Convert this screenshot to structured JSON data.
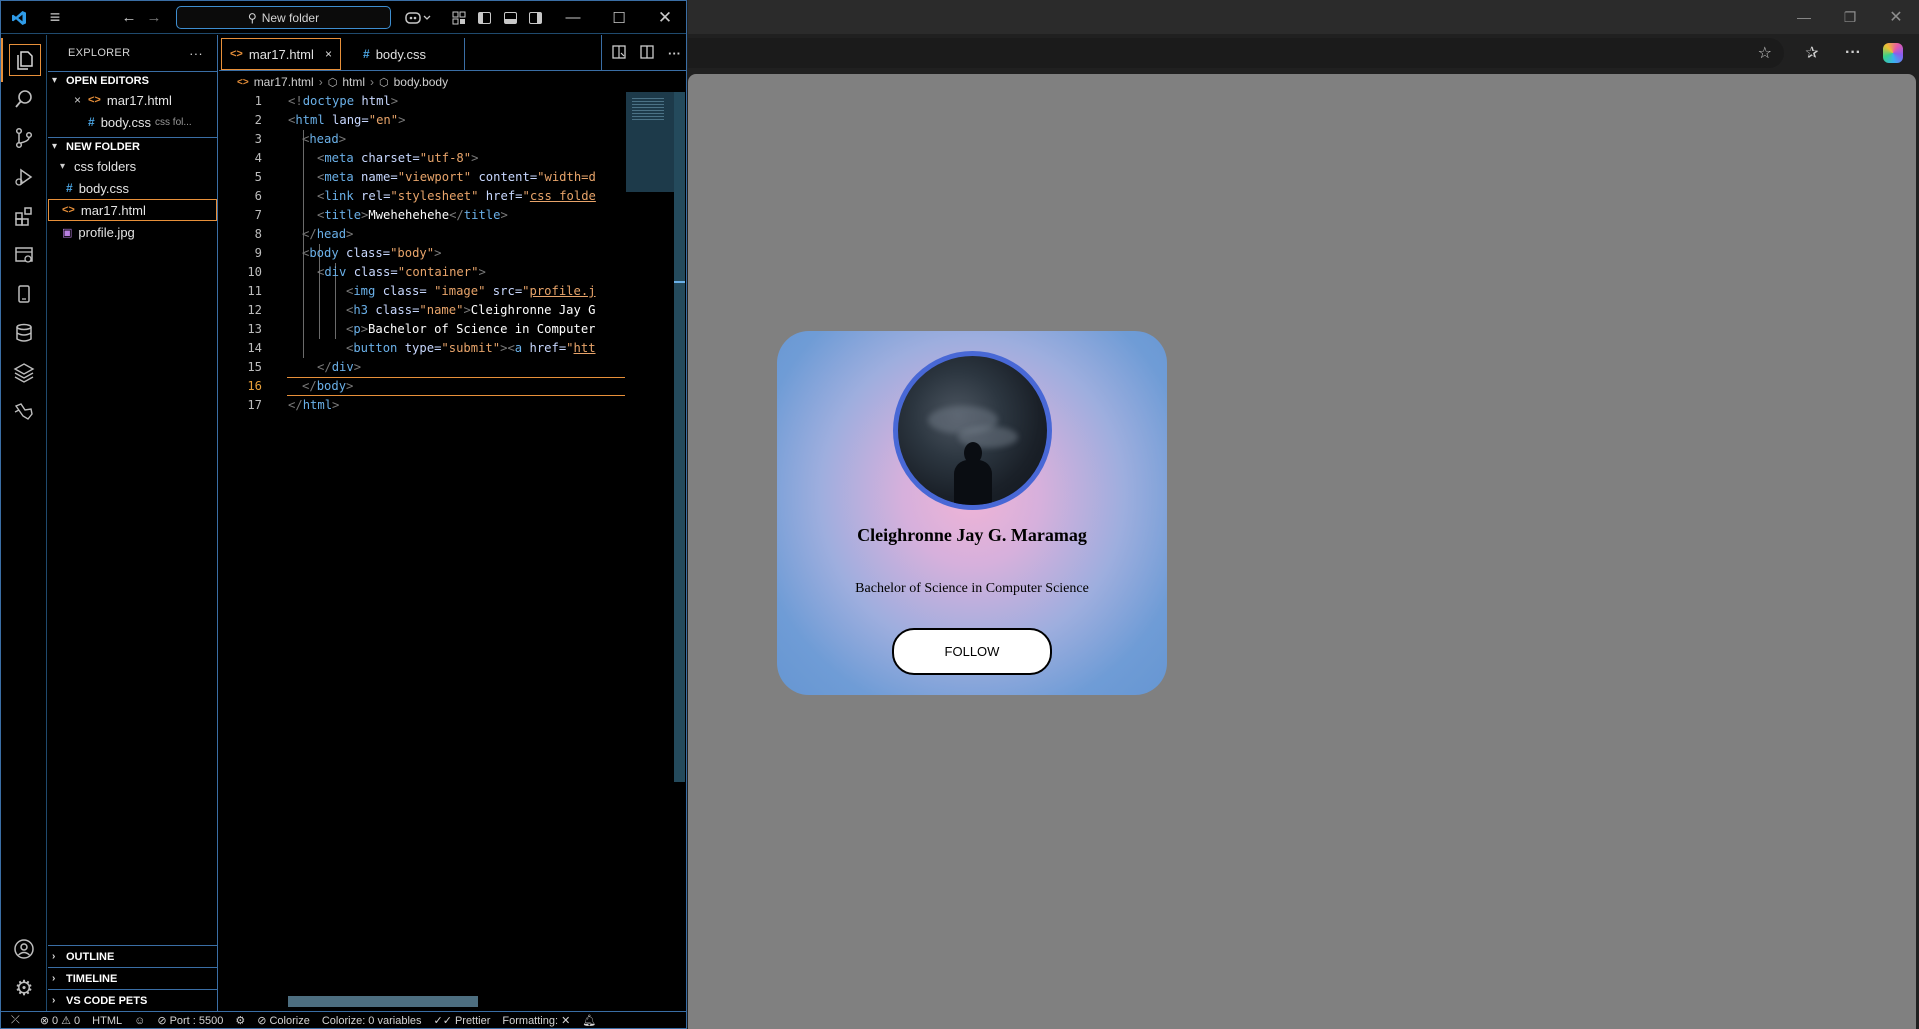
{
  "vscode": {
    "search_box": "New folder",
    "explorer": {
      "title": "EXPLORER",
      "more": "···",
      "open_editors_label": "OPEN EDITORS",
      "open_editors": [
        {
          "close": "×",
          "name": "mar17.html"
        },
        {
          "name": "body.css",
          "desc": "css fol..."
        }
      ],
      "folder_label": "NEW FOLDER",
      "tree": [
        {
          "name": "css folders"
        },
        {
          "name": "body.css"
        },
        {
          "name": "mar17.html"
        },
        {
          "name": "profile.jpg"
        }
      ],
      "outline_label": "OUTLINE",
      "timeline_label": "TIMELINE",
      "pets_label": "VS CODE PETS"
    },
    "tabs": [
      {
        "label": "mar17.html",
        "close": "×"
      },
      {
        "label": "body.css"
      }
    ],
    "breadcrumb": [
      "mar17.html",
      "html",
      "body.body"
    ],
    "line_numbers": [
      "1",
      "2",
      "3",
      "4",
      "5",
      "6",
      "7",
      "8",
      "9",
      "10",
      "11",
      "12",
      "13",
      "14",
      "15",
      "16",
      "17"
    ],
    "current_line": 16,
    "code": {
      "l1": {
        "a": "<!",
        "b": "doctype",
        "c": " html",
        "d": ">"
      },
      "l2": {
        "a": "<",
        "b": "html",
        "c": " lang",
        "d": "=",
        "e": "\"en\"",
        "f": ">"
      },
      "l3": {
        "a": "<",
        "b": "head",
        "c": ">"
      },
      "l4": {
        "a": "<",
        "b": "meta",
        "c": " charset",
        "d": "=",
        "e": "\"utf-8\"",
        "f": ">"
      },
      "l5": {
        "a": "<",
        "b": "meta",
        "c": " name",
        "d": "=",
        "e": "\"viewport\"",
        "f": " content",
        "g": "=",
        "h": "\"width=d"
      },
      "l6": {
        "a": "<",
        "b": "link",
        "c": " rel",
        "d": "=",
        "e": "\"stylesheet\"",
        "f": " href",
        "g": "=",
        "h": "\"",
        "i": "css folde"
      },
      "l7": {
        "a": "<",
        "b": "title",
        "c": ">",
        "d": "Mwehehehehe",
        "e": "</",
        "f": "title",
        "g": ">"
      },
      "l8": {
        "a": "</",
        "b": "head",
        "c": ">"
      },
      "l9": {
        "a": "<",
        "b": "body",
        "c": " class",
        "d": "=",
        "e": "\"body\"",
        "f": ">"
      },
      "l10": {
        "a": "<",
        "b": "div",
        "c": " class",
        "d": "=",
        "e": "\"container\"",
        "f": ">"
      },
      "l11": {
        "a": "<",
        "b": "img",
        "c": " class",
        "d": "= ",
        "e": "\"image\"",
        "f": " src",
        "g": "=",
        "h": "\"",
        "i": "profile.j"
      },
      "l12": {
        "a": "<",
        "b": "h3",
        "c": " class",
        "d": "=",
        "e": "\"name\"",
        "f": ">",
        "g": "Cleighronne Jay G"
      },
      "l13": {
        "a": "<",
        "b": "p",
        "c": ">",
        "d": "Bachelor of Science in Computer"
      },
      "l14": {
        "a": "<",
        "b": "button",
        "c": " type",
        "d": "=",
        "e": "\"submit\"",
        "f": "><",
        "g": "a",
        "h": " href",
        "i": "=",
        "j": "\"",
        "k": "htt"
      },
      "l15": {
        "a": "</",
        "b": "div",
        "c": ">"
      },
      "l16": {
        "a": "</",
        "b": "body",
        "c": ">"
      },
      "l17": {
        "a": "</",
        "b": "html",
        "c": ">"
      }
    },
    "status": {
      "errors": "0",
      "warnings": "0",
      "language": "HTML",
      "port": "Port : 5500",
      "colorize": "Colorize",
      "colorize_vars": "Colorize: 0 variables",
      "prettier": "Prettier",
      "formatting": "Formatting: ✕"
    }
  },
  "browser": {
    "profile": {
      "name": "Cleighronne Jay G. Maramag",
      "degree": "Bachelor of Science in Computer Science",
      "follow_label": "FOLLOW"
    }
  },
  "colors": {
    "accent_orange": "#e8903a",
    "accent_blue": "#3a6ea5",
    "avatar_border": "#4868d6",
    "page_bg": "#808080"
  }
}
